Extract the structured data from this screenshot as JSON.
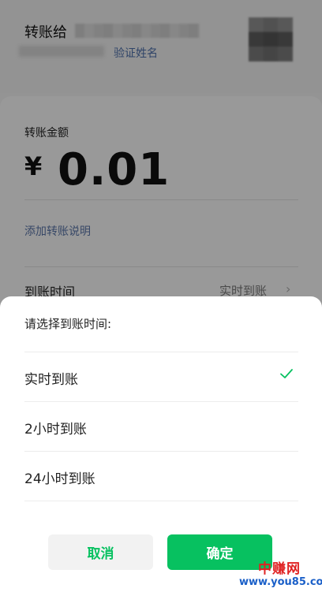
{
  "header": {
    "transfer_to_label": "转账给",
    "verify_name_link": "验证姓名"
  },
  "amount_section": {
    "label": "转账金额",
    "currency_symbol": "¥",
    "value": "0.01",
    "add_note_link": "添加转账说明"
  },
  "arrival_row": {
    "label": "到账时间",
    "value": "实时到账"
  },
  "sheet": {
    "title": "请选择到账时间:",
    "options": [
      {
        "label": "实时到账",
        "selected": true
      },
      {
        "label": "2小时到账",
        "selected": false
      },
      {
        "label": "24小时到账",
        "selected": false
      }
    ],
    "cancel_label": "取消",
    "confirm_label": "确定"
  },
  "watermark": {
    "brand": "中赚网",
    "url": "www.you85.com"
  },
  "colors": {
    "accent_green": "#07c160",
    "link_blue": "#5a74a6"
  }
}
